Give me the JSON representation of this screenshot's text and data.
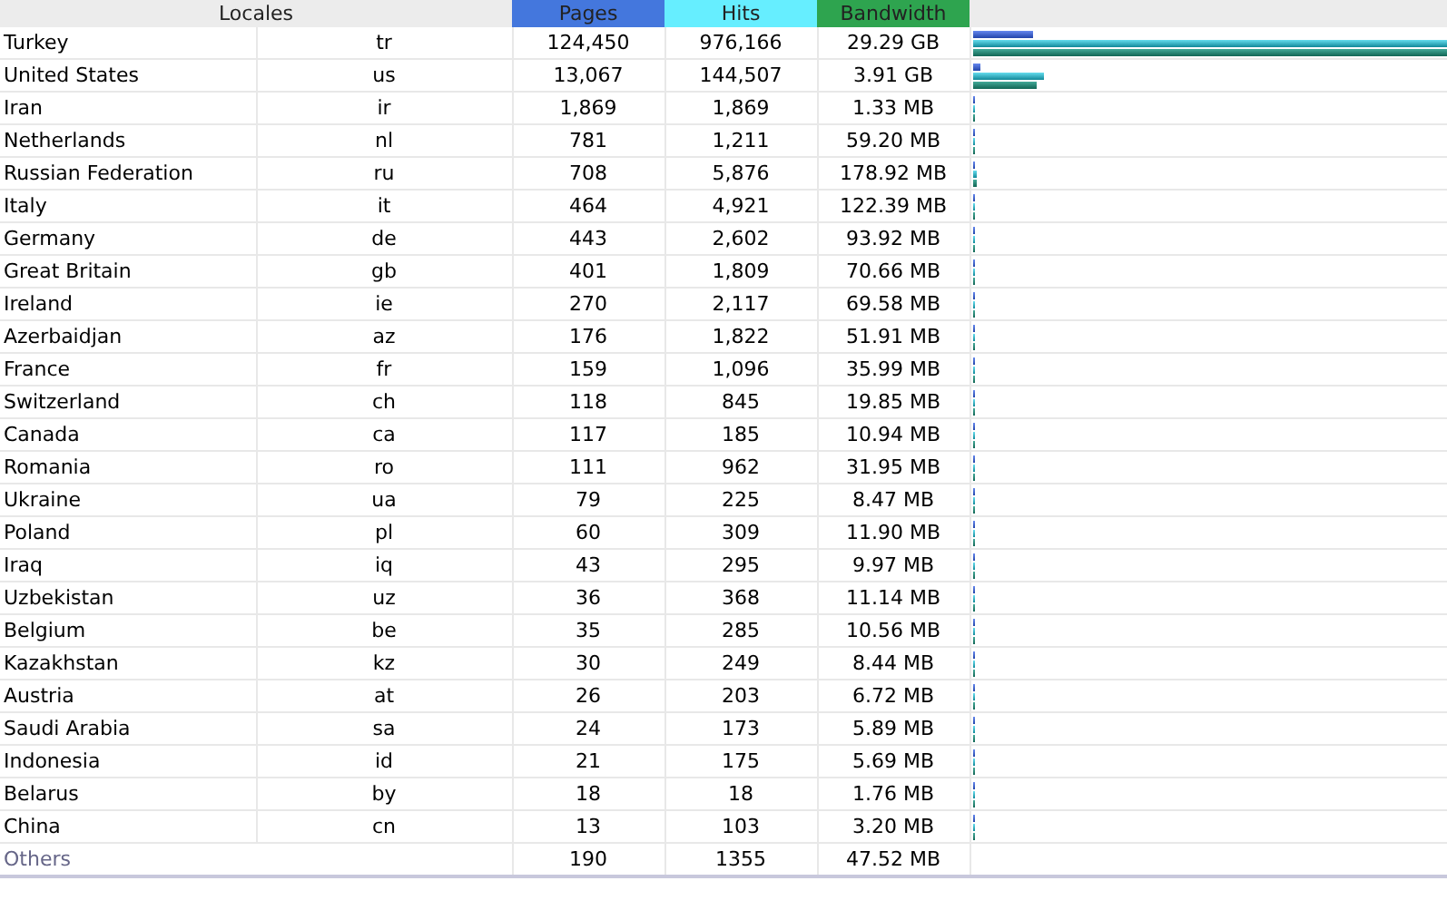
{
  "table": {
    "columns": [
      {
        "label": "Locales",
        "kind": "locale"
      },
      {
        "label": "Pages",
        "kind": "pages"
      },
      {
        "label": "Hits",
        "kind": "hits"
      },
      {
        "label": "Bandwidth",
        "kind": "bandwidth"
      }
    ],
    "rows": [
      {
        "name": "Turkey",
        "code": "tr",
        "pages": "124,450",
        "hits": "976,166",
        "bandwidth": "29.29 GB",
        "bars": [
          {
            "kind": "pages",
            "level": 0.1275
          },
          {
            "kind": "hits",
            "level": 1
          },
          {
            "kind": "bandwidth",
            "level": 1
          }
        ]
      },
      {
        "name": "United States",
        "code": "us",
        "pages": "13,067",
        "hits": "144,507",
        "bandwidth": "3.91 GB",
        "bars": [
          {
            "kind": "pages",
            "level": 0.0134
          },
          {
            "kind": "hits",
            "level": 0.148
          },
          {
            "kind": "bandwidth",
            "level": 0.1335
          }
        ]
      },
      {
        "name": "Iran",
        "code": "ir",
        "pages": "1,869",
        "hits": "1,869",
        "bandwidth": "1.33 MB",
        "bars": [
          {
            "kind": "pages",
            "level": 0.0019
          },
          {
            "kind": "hits",
            "level": 0.0019
          },
          {
            "kind": "bandwidth",
            "level": 0.0001
          }
        ]
      },
      {
        "name": "Netherlands",
        "code": "nl",
        "pages": "781",
        "hits": "1,211",
        "bandwidth": "59.20 MB",
        "bars": [
          {
            "kind": "pages",
            "level": 0.0008
          },
          {
            "kind": "hits",
            "level": 0.0012
          },
          {
            "kind": "bandwidth",
            "level": 0.002
          }
        ]
      },
      {
        "name": "Russian Federation",
        "code": "ru",
        "pages": "708",
        "hits": "5,876",
        "bandwidth": "178.92 MB",
        "bars": [
          {
            "kind": "pages",
            "level": 0.0007
          },
          {
            "kind": "hits",
            "level": 0.006
          },
          {
            "kind": "bandwidth",
            "level": 0.006
          }
        ]
      },
      {
        "name": "Italy",
        "code": "it",
        "pages": "464",
        "hits": "4,921",
        "bandwidth": "122.39 MB",
        "bars": [
          {
            "kind": "pages",
            "level": 0.0005
          },
          {
            "kind": "hits",
            "level": 0.005
          },
          {
            "kind": "bandwidth",
            "level": 0.0041
          }
        ]
      },
      {
        "name": "Germany",
        "code": "de",
        "pages": "443",
        "hits": "2,602",
        "bandwidth": "93.92 MB",
        "bars": [
          {
            "kind": "pages",
            "level": 0.0005
          },
          {
            "kind": "hits",
            "level": 0.0027
          },
          {
            "kind": "bandwidth",
            "level": 0.0031
          }
        ]
      },
      {
        "name": "Great Britain",
        "code": "gb",
        "pages": "401",
        "hits": "1,809",
        "bandwidth": "70.66 MB",
        "bars": [
          {
            "kind": "pages",
            "level": 0.0004
          },
          {
            "kind": "hits",
            "level": 0.0019
          },
          {
            "kind": "bandwidth",
            "level": 0.0024
          }
        ]
      },
      {
        "name": "Ireland",
        "code": "ie",
        "pages": "270",
        "hits": "2,117",
        "bandwidth": "69.58 MB",
        "bars": [
          {
            "kind": "pages",
            "level": 0.0003
          },
          {
            "kind": "hits",
            "level": 0.0022
          },
          {
            "kind": "bandwidth",
            "level": 0.0023
          }
        ]
      },
      {
        "name": "Azerbaidjan",
        "code": "az",
        "pages": "176",
        "hits": "1,822",
        "bandwidth": "51.91 MB",
        "bars": [
          {
            "kind": "pages",
            "level": 0.0002
          },
          {
            "kind": "hits",
            "level": 0.0019
          },
          {
            "kind": "bandwidth",
            "level": 0.0017
          }
        ]
      },
      {
        "name": "France",
        "code": "fr",
        "pages": "159",
        "hits": "1,096",
        "bandwidth": "35.99 MB",
        "bars": [
          {
            "kind": "pages",
            "level": 0.0002
          },
          {
            "kind": "hits",
            "level": 0.0011
          },
          {
            "kind": "bandwidth",
            "level": 0.0012
          }
        ]
      },
      {
        "name": "Switzerland",
        "code": "ch",
        "pages": "118",
        "hits": "845",
        "bandwidth": "19.85 MB",
        "bars": [
          {
            "kind": "pages",
            "level": 0.0001
          },
          {
            "kind": "hits",
            "level": 0.0009
          },
          {
            "kind": "bandwidth",
            "level": 0.0007
          }
        ]
      },
      {
        "name": "Canada",
        "code": "ca",
        "pages": "117",
        "hits": "185",
        "bandwidth": "10.94 MB",
        "bars": [
          {
            "kind": "pages",
            "level": 0.0001
          },
          {
            "kind": "hits",
            "level": 0.0002
          },
          {
            "kind": "bandwidth",
            "level": 0.0004
          }
        ]
      },
      {
        "name": "Romania",
        "code": "ro",
        "pages": "111",
        "hits": "962",
        "bandwidth": "31.95 MB",
        "bars": [
          {
            "kind": "pages",
            "level": 0.0001
          },
          {
            "kind": "hits",
            "level": 0.001
          },
          {
            "kind": "bandwidth",
            "level": 0.0011
          }
        ]
      },
      {
        "name": "Ukraine",
        "code": "ua",
        "pages": "79",
        "hits": "225",
        "bandwidth": "8.47 MB",
        "bars": [
          {
            "kind": "pages",
            "level": 0.0001
          },
          {
            "kind": "hits",
            "level": 0.0002
          },
          {
            "kind": "bandwidth",
            "level": 0.0003
          }
        ]
      },
      {
        "name": "Poland",
        "code": "pl",
        "pages": "60",
        "hits": "309",
        "bandwidth": "11.90 MB",
        "bars": [
          {
            "kind": "pages",
            "level": 0.0001
          },
          {
            "kind": "hits",
            "level": 0.0003
          },
          {
            "kind": "bandwidth",
            "level": 0.0004
          }
        ]
      },
      {
        "name": "Iraq",
        "code": "iq",
        "pages": "43",
        "hits": "295",
        "bandwidth": "9.97 MB",
        "bars": [
          {
            "kind": "pages",
            "level": 0.0001
          },
          {
            "kind": "hits",
            "level": 0.0003
          },
          {
            "kind": "bandwidth",
            "level": 0.0003
          }
        ]
      },
      {
        "name": "Uzbekistan",
        "code": "uz",
        "pages": "36",
        "hits": "368",
        "bandwidth": "11.14 MB",
        "bars": [
          {
            "kind": "pages",
            "level": 0.0001
          },
          {
            "kind": "hits",
            "level": 0.0004
          },
          {
            "kind": "bandwidth",
            "level": 0.0004
          }
        ]
      },
      {
        "name": "Belgium",
        "code": "be",
        "pages": "35",
        "hits": "285",
        "bandwidth": "10.56 MB",
        "bars": [
          {
            "kind": "pages",
            "level": 0.0001
          },
          {
            "kind": "hits",
            "level": 0.0003
          },
          {
            "kind": "bandwidth",
            "level": 0.0004
          }
        ]
      },
      {
        "name": "Kazakhstan",
        "code": "kz",
        "pages": "30",
        "hits": "249",
        "bandwidth": "8.44 MB",
        "bars": [
          {
            "kind": "pages",
            "level": 0.0001
          },
          {
            "kind": "hits",
            "level": 0.0003
          },
          {
            "kind": "bandwidth",
            "level": 0.0003
          }
        ]
      },
      {
        "name": "Austria",
        "code": "at",
        "pages": "26",
        "hits": "203",
        "bandwidth": "6.72 MB",
        "bars": [
          {
            "kind": "pages",
            "level": 0.0001
          },
          {
            "kind": "hits",
            "level": 0.0002
          },
          {
            "kind": "bandwidth",
            "level": 0.0002
          }
        ]
      },
      {
        "name": "Saudi Arabia",
        "code": "sa",
        "pages": "24",
        "hits": "173",
        "bandwidth": "5.89 MB",
        "bars": [
          {
            "kind": "pages",
            "level": 0.0001
          },
          {
            "kind": "hits",
            "level": 0.0002
          },
          {
            "kind": "bandwidth",
            "level": 0.0002
          }
        ]
      },
      {
        "name": "Indonesia",
        "code": "id",
        "pages": "21",
        "hits": "175",
        "bandwidth": "5.69 MB",
        "bars": [
          {
            "kind": "pages",
            "level": 0.0001
          },
          {
            "kind": "hits",
            "level": 0.0002
          },
          {
            "kind": "bandwidth",
            "level": 0.0002
          }
        ]
      },
      {
        "name": "Belarus",
        "code": "by",
        "pages": "18",
        "hits": "18",
        "bandwidth": "1.76 MB",
        "bars": [
          {
            "kind": "pages",
            "level": 0.0001
          },
          {
            "kind": "hits",
            "level": 0.0001
          },
          {
            "kind": "bandwidth",
            "level": 0.0001
          }
        ]
      },
      {
        "name": "China",
        "code": "cn",
        "pages": "13",
        "hits": "103",
        "bandwidth": "3.20 MB",
        "bars": [
          {
            "kind": "pages",
            "level": 0.0001
          },
          {
            "kind": "hits",
            "level": 0.0001
          },
          {
            "kind": "bandwidth",
            "level": 0.0001
          }
        ]
      }
    ],
    "others": {
      "name": "Others",
      "pages": "190",
      "hits": "1355",
      "bandwidth": "47.52 MB"
    }
  }
}
